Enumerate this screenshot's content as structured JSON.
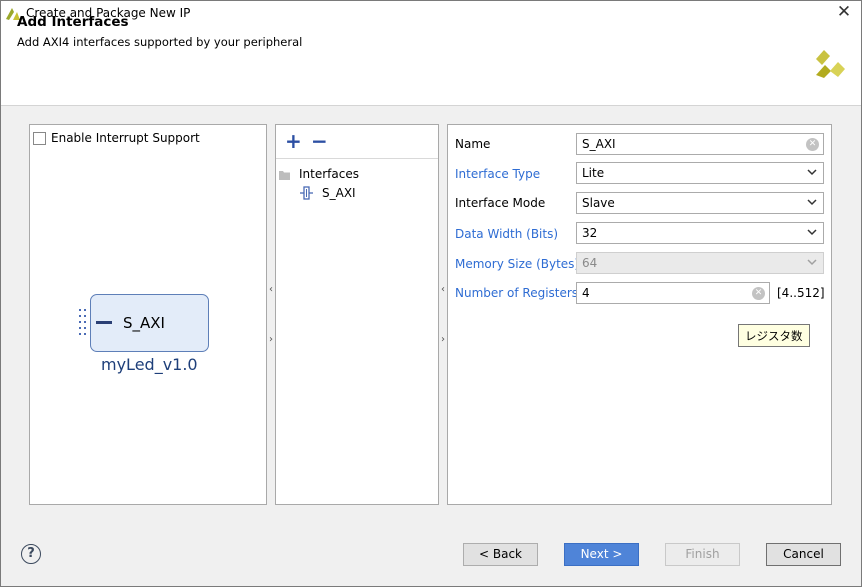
{
  "window": {
    "title": "Create and Package New IP",
    "close_label": "✕"
  },
  "header": {
    "title": "Add Interfaces",
    "subtitle": "Add AXI4 interfaces supported by your peripheral"
  },
  "left_panel": {
    "interrupt_checkbox_label": "Enable Interrupt Support",
    "interrupt_checked": false,
    "ip_block": {
      "interface_label": "S_AXI",
      "ip_name": "myLed_v1.0"
    }
  },
  "middle_panel": {
    "add_label": "+",
    "remove_label": "−",
    "tree": {
      "root_label": "Interfaces",
      "children": [
        "S_AXI"
      ]
    }
  },
  "form": {
    "name": {
      "label": "Name",
      "value": "S_AXI"
    },
    "interface_type": {
      "label": "Interface Type",
      "value": "Lite"
    },
    "interface_mode": {
      "label": "Interface Mode",
      "value": "Slave"
    },
    "data_width": {
      "label": "Data Width (Bits)",
      "value": "32"
    },
    "memory_size": {
      "label": "Memory Size (Bytes)",
      "value": "64",
      "disabled": true
    },
    "num_registers": {
      "label": "Number of Registers",
      "value": "4",
      "range": "[4..512]"
    },
    "tooltip": "レジスタ数"
  },
  "footer": {
    "help_label": "?",
    "back_label": "< Back",
    "next_label": "Next >",
    "finish_label": "Finish",
    "cancel_label": "Cancel"
  },
  "colors": {
    "accent_blue": "#4f84d8",
    "link_blue": "#2e6cd3",
    "xilinx_logo": "#b4ad28"
  }
}
